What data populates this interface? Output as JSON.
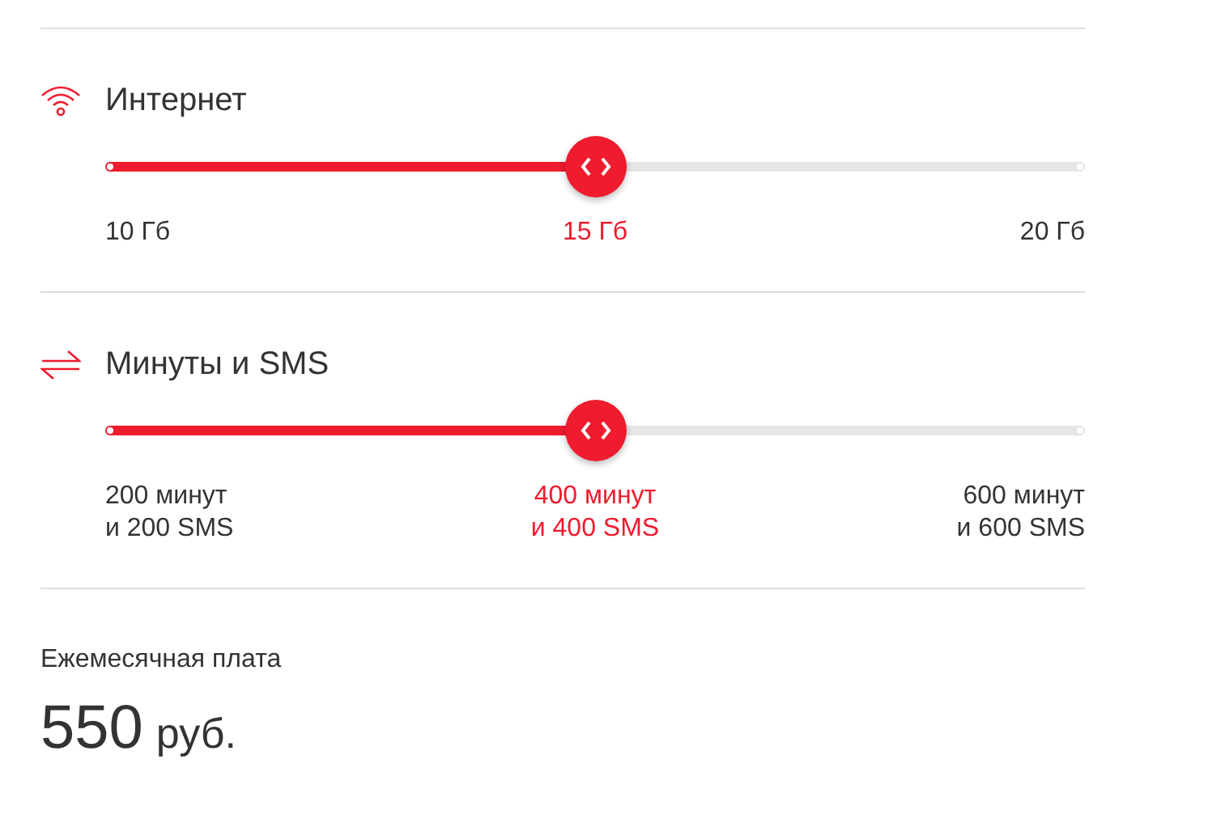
{
  "sections": [
    {
      "kind": "wifi",
      "title": "Интернет",
      "slider": {
        "level": 0.5
      },
      "marks": [
        {
          "lines": [
            "10 Гб"
          ],
          "selected": false
        },
        {
          "lines": [
            "15 Гб"
          ],
          "selected": true
        },
        {
          "lines": [
            "20 Гб"
          ],
          "selected": false
        }
      ]
    },
    {
      "kind": "exchange",
      "title": "Минуты и SMS",
      "slider": {
        "level": 0.5
      },
      "marks": [
        {
          "lines": [
            "200 минут",
            "и 200 SMS"
          ],
          "selected": false
        },
        {
          "lines": [
            "400 минут",
            "и 400 SMS"
          ],
          "selected": true
        },
        {
          "lines": [
            "600 минут",
            "и 600 SMS"
          ],
          "selected": false
        }
      ]
    }
  ],
  "fee": {
    "label": "Ежемесячная плата",
    "amount": "550",
    "currency": "руб."
  }
}
